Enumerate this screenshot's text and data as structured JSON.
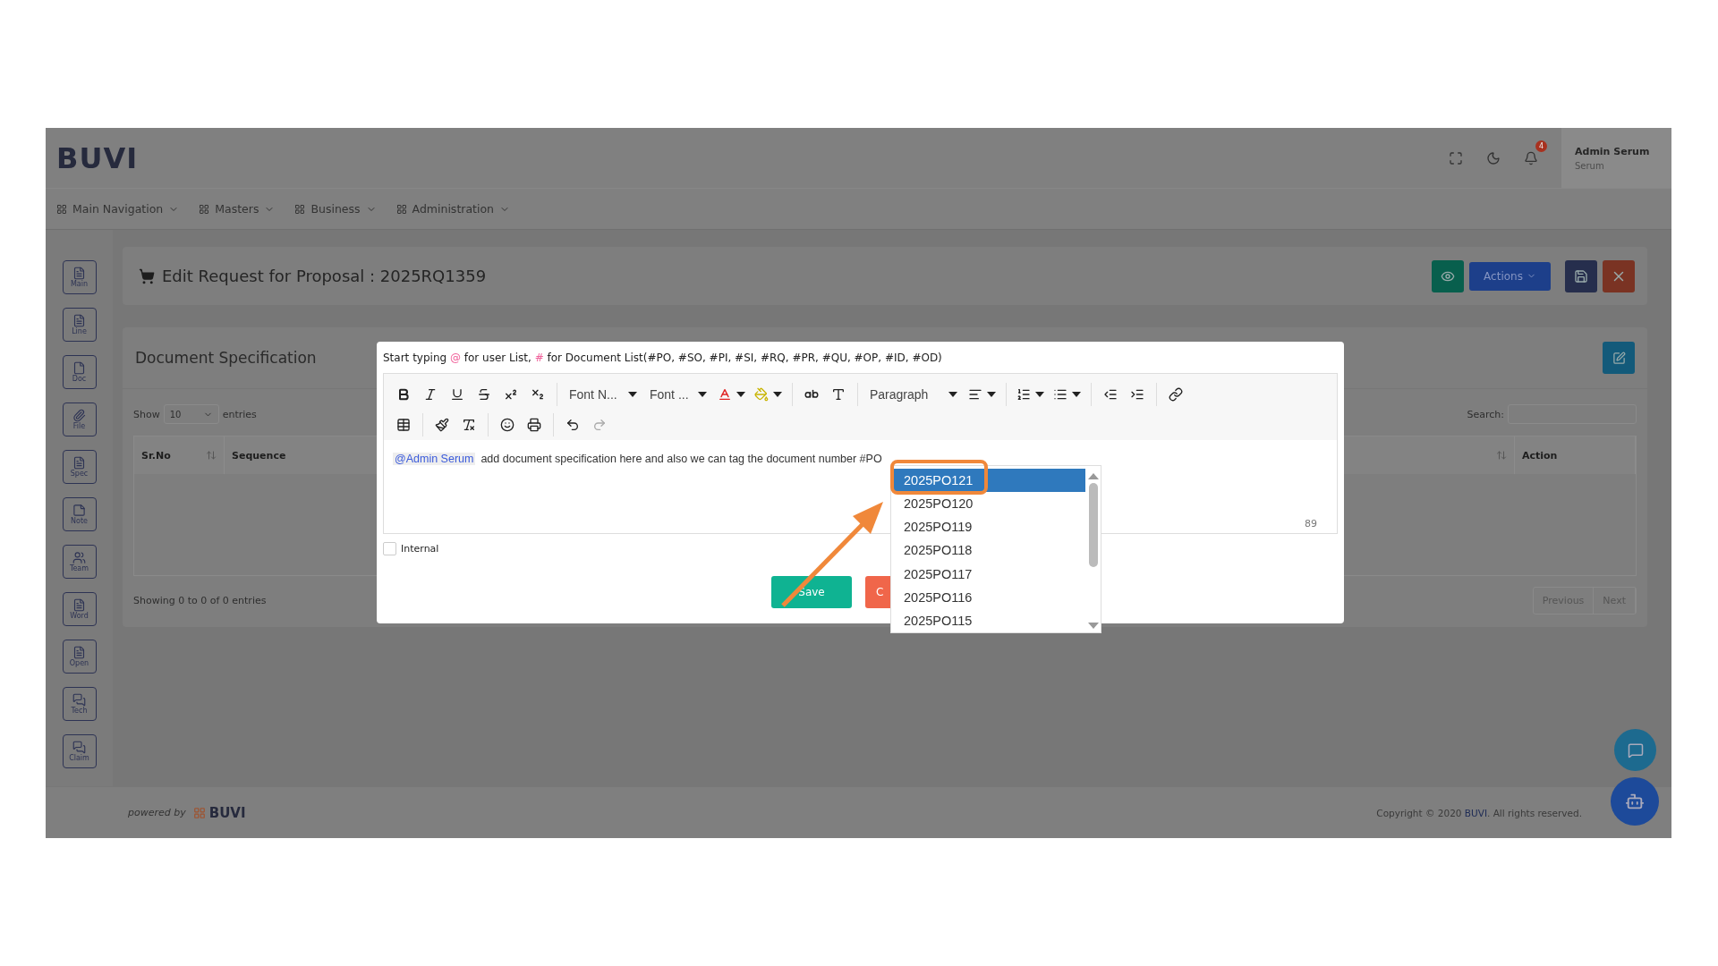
{
  "header": {
    "logo": "BUVI",
    "notification_count": "4",
    "user_name": "Admin Serum",
    "user_role": "Serum"
  },
  "nav": [
    {
      "label": "Main Navigation"
    },
    {
      "label": "Masters"
    },
    {
      "label": "Business"
    },
    {
      "label": "Administration"
    }
  ],
  "sidebar": [
    {
      "label": "Main",
      "kind": "list"
    },
    {
      "label": "Line",
      "kind": "list"
    },
    {
      "label": "Doc",
      "kind": "page"
    },
    {
      "label": "File",
      "kind": "clip"
    },
    {
      "label": "Spec",
      "kind": "list"
    },
    {
      "label": "Note",
      "kind": "note"
    },
    {
      "label": "Team",
      "kind": "team"
    },
    {
      "label": "Word",
      "kind": "list"
    },
    {
      "label": "Open",
      "kind": "list"
    },
    {
      "label": "Tech",
      "kind": "chat"
    },
    {
      "label": "Claim",
      "kind": "chat"
    }
  ],
  "page": {
    "title": "Edit Request for Proposal : 2025RQ1359",
    "actions_label": "Actions"
  },
  "spec_card": {
    "title": "Document Specification",
    "show_label": "Show",
    "page_size": "10",
    "entries_label": "entries",
    "search_label": "Search:",
    "columns": [
      {
        "label": "Sr.No",
        "sort": true
      },
      {
        "label": "Sequence"
      },
      {
        "sort": true
      },
      {
        "label": "Action",
        "sort": false
      }
    ],
    "info": "Showing 0 to 0 of 0 entries",
    "pager": [
      "Previous",
      "Next"
    ]
  },
  "modal": {
    "hint": [
      {
        "text": "Start typing ",
        "kind": "plain"
      },
      {
        "text": "@",
        "kind": "symbol"
      },
      {
        "text": " for user List, ",
        "kind": "plain"
      },
      {
        "text": "#",
        "kind": "symbol"
      },
      {
        "text": " for Document List(#PO, #SO, #PI, #SI, #RQ, #PR, #QU, #OP, #ID, #OD)",
        "kind": "plain"
      }
    ],
    "font_name": "Font N...",
    "font_size": "Font ...",
    "block_format": "Paragraph",
    "mention": "@Admin Serum",
    "content": "add document specification here and also we can tag the document number #PO",
    "char_count": "89",
    "internal": {
      "label": "Internal",
      "checked": false
    },
    "save_label": "Save",
    "cancel_label": "C",
    "suggestions": [
      {
        "label": "2025PO121",
        "selected": true
      },
      {
        "label": "2025PO120",
        "selected": false
      },
      {
        "label": "2025PO119",
        "selected": false
      },
      {
        "label": "2025PO118",
        "selected": false
      },
      {
        "label": "2025PO117",
        "selected": false
      },
      {
        "label": "2025PO116",
        "selected": false
      },
      {
        "label": "2025PO115",
        "selected": false
      }
    ]
  },
  "footer": {
    "powered_by": "powered by",
    "logo": "BUVI",
    "copyright": "Copyright © 2020 **BUVI**. All rights reserved."
  }
}
